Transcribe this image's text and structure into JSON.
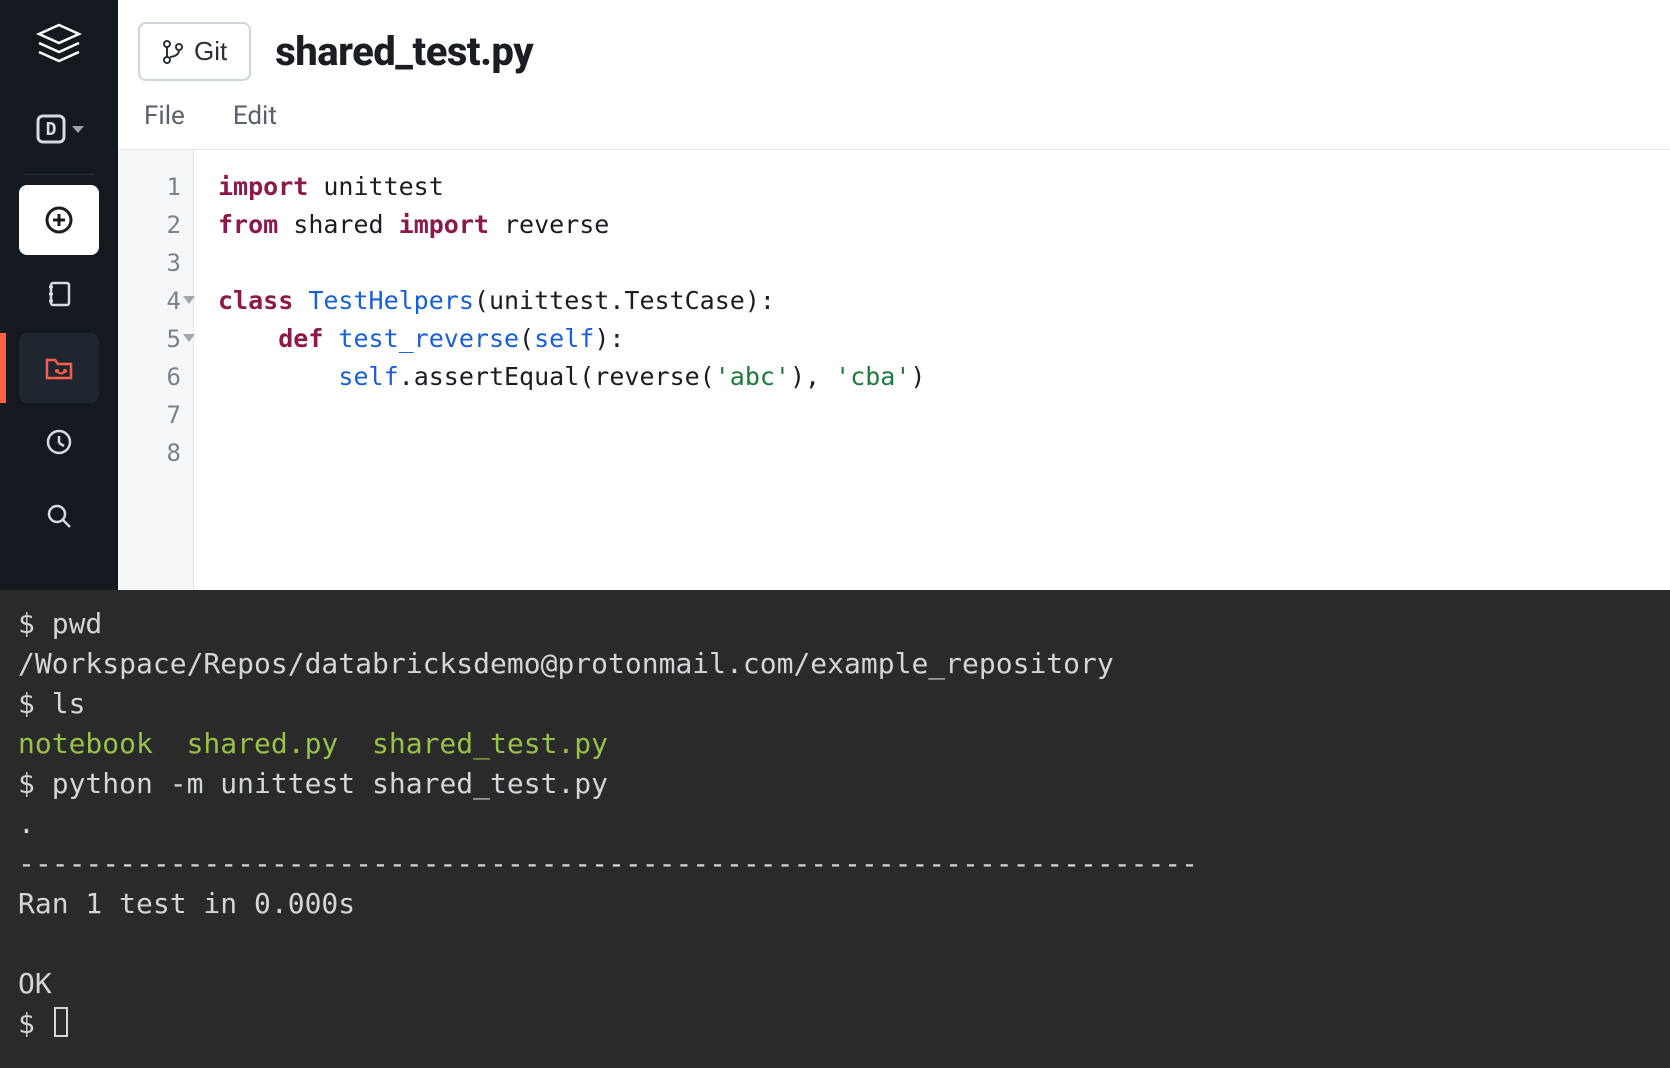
{
  "header": {
    "git_button_label": "Git",
    "file_title": "shared_test.py"
  },
  "menu": {
    "file": "File",
    "edit": "Edit"
  },
  "sidebar": {
    "icons": [
      "logo",
      "data",
      "create",
      "notebook",
      "repos",
      "recents",
      "search"
    ]
  },
  "editor": {
    "lines": [
      {
        "n": "1",
        "fold": false
      },
      {
        "n": "2",
        "fold": false
      },
      {
        "n": "3",
        "fold": false
      },
      {
        "n": "4",
        "fold": true
      },
      {
        "n": "5",
        "fold": true
      },
      {
        "n": "6",
        "fold": false
      },
      {
        "n": "7",
        "fold": false
      },
      {
        "n": "8",
        "fold": false
      }
    ],
    "code": {
      "l1_kw1": "import",
      "l1_rest": " unittest",
      "l2_kw1": "from",
      "l2_mid": " shared ",
      "l2_kw2": "import",
      "l2_rest": " reverse",
      "l4_kw": "class",
      "l4_cls": " TestHelpers",
      "l4_rest": "(unittest.TestCase):",
      "l5_indent": "    ",
      "l5_kw": "def",
      "l5_fn": " test_reverse",
      "l5_self_open": "(",
      "l5_self": "self",
      "l5_self_close": "):",
      "l6_indent": "        ",
      "l6_self": "self",
      "l6_call": ".assertEqual(reverse(",
      "l6_str1": "'abc'",
      "l6_mid": "), ",
      "l6_str2": "'cba'",
      "l6_end": ")"
    }
  },
  "terminal": {
    "prompt": "$ ",
    "cmd_pwd": "pwd",
    "pwd_output": "/Workspace/Repos/databricksdemo@protonmail.com/example_repository",
    "cmd_ls": "ls",
    "ls_output": "notebook  shared.py  shared_test.py",
    "cmd_unittest": "python -m unittest shared_test.py",
    "dot_line": ".",
    "dash_line": "----------------------------------------------------------------------",
    "ran_line": "Ran 1 test in 0.000s",
    "ok_line": "OK"
  }
}
